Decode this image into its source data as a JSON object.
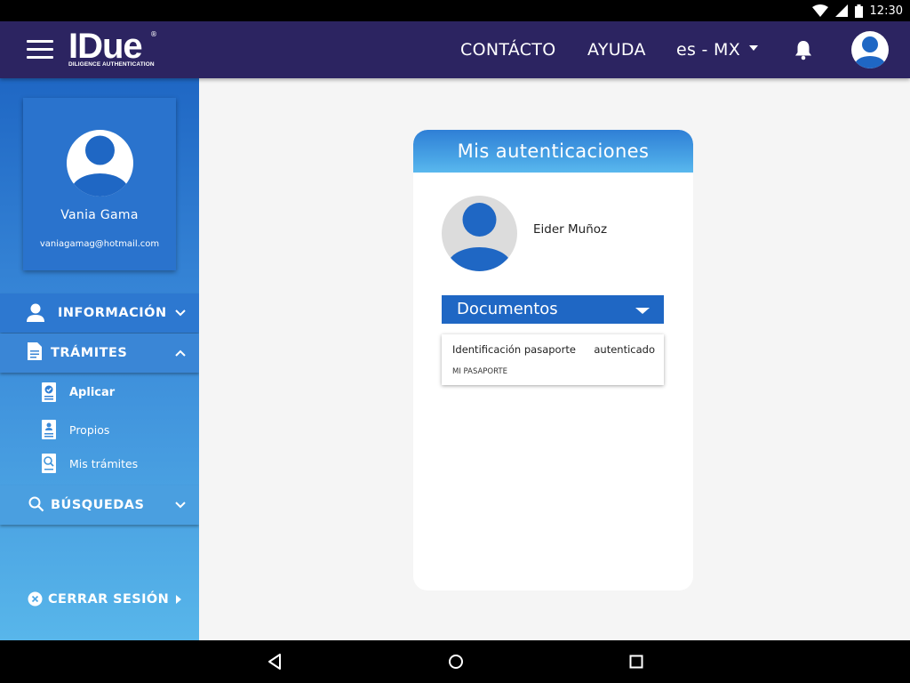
{
  "status_bar": {
    "time": "12:30",
    "icons": [
      "wifi-icon",
      "signal-icon",
      "battery-icon"
    ]
  },
  "header": {
    "logo_text": "IDue",
    "logo_registered": "®",
    "logo_subtitle": "DILIGENCE AUTHENTICATION",
    "nav": {
      "contacto": "CONTÁCTO",
      "ayuda": "AYUDA",
      "language": "es - MX"
    },
    "icons": [
      "menu-icon",
      "bell-icon",
      "user-avatar-icon"
    ]
  },
  "sidebar": {
    "user_name": "Vania Gama",
    "user_email": "vaniagamag@hotmail.com",
    "sections": {
      "informacion": "INFORMACIÓN",
      "tramites": "TRÁMITES",
      "busquedas": "BÚSQUEDAS"
    },
    "tramites_items": {
      "aplicar": "Aplicar",
      "propios": "Propios",
      "mis_tramites": "Mis trámites"
    },
    "logout": "CERRAR SESIÓN"
  },
  "main": {
    "card_title": "Mis autenticaciones",
    "person_name": "Eider Muñoz",
    "documents_header": "Documentos",
    "documents": [
      {
        "title": "Identificación pasaporte",
        "status": "autenticado",
        "subtitle": "MI PASAPORTE"
      }
    ]
  },
  "colors": {
    "app_bar": "#2c2461",
    "accent_blue": "#1f67c4",
    "light_blue": "#58b6ea",
    "background": "#f5f5f5"
  }
}
